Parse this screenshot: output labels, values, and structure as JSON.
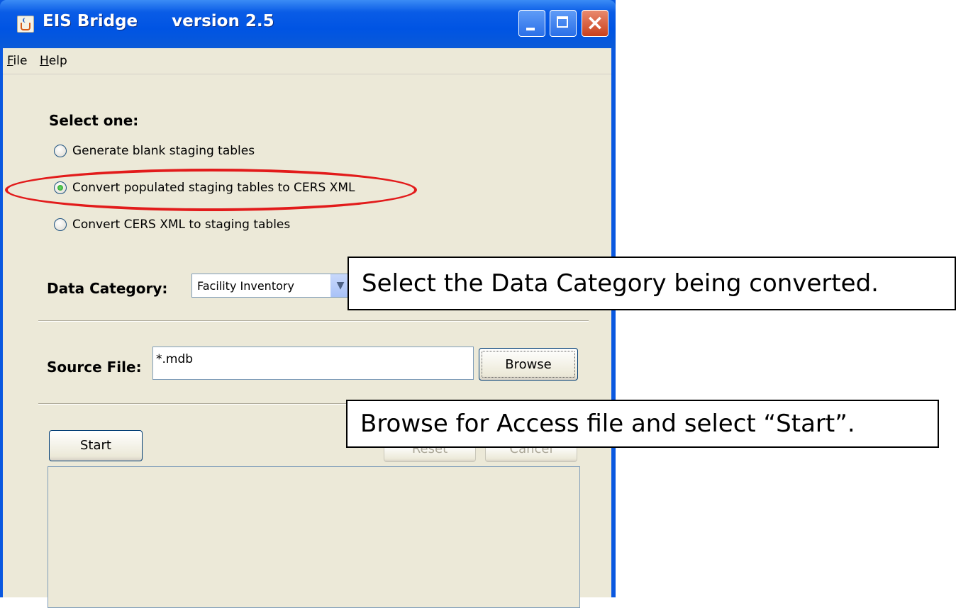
{
  "window": {
    "title": "EIS Bridge      version 2.5",
    "icon": "java-cup-icon"
  },
  "menu": {
    "file": {
      "label_first": "F",
      "label_rest": "ile"
    },
    "help": {
      "label_first": "H",
      "label_rest": "elp"
    }
  },
  "mode": {
    "heading": "Select one:",
    "options": [
      {
        "label": "Generate blank staging tables",
        "selected": false
      },
      {
        "label": "Convert populated staging tables to CERS XML",
        "selected": true
      },
      {
        "label": "Convert CERS XML to staging tables",
        "selected": false
      }
    ]
  },
  "data_category": {
    "label": "Data Category:",
    "value": "Facility Inventory"
  },
  "source_file": {
    "label": "Source File:",
    "value": "*.mdb",
    "browse_label": "Browse"
  },
  "actions": {
    "start_label": "Start",
    "reset_label": "Reset",
    "cancel_label": "Cancel"
  },
  "annotations": {
    "callout_1": "Select the Data Category being converted.",
    "callout_2": "Browse for Access file and select “Start”.",
    "highlight_color": "#e21b1b"
  }
}
